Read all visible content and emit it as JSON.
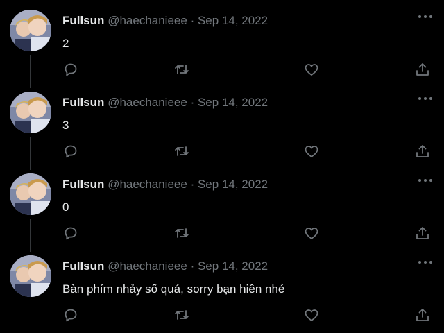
{
  "tweets": [
    {
      "name": "Fullsun",
      "handle": "@haechanieee",
      "separator": "·",
      "date": "Sep 14, 2022",
      "text": "2"
    },
    {
      "name": "Fullsun",
      "handle": "@haechanieee",
      "separator": "·",
      "date": "Sep 14, 2022",
      "text": "3"
    },
    {
      "name": "Fullsun",
      "handle": "@haechanieee",
      "separator": "·",
      "date": "Sep 14, 2022",
      "text": "0"
    },
    {
      "name": "Fullsun",
      "handle": "@haechanieee",
      "separator": "·",
      "date": "Sep 14, 2022",
      "text": "Bàn phím nhảy số quá, sorry bạn hiền nhé"
    }
  ],
  "icons": {
    "more": "more-icon",
    "reply": "reply-icon",
    "retweet": "retweet-icon",
    "like": "like-icon",
    "share": "share-icon"
  },
  "colors": {
    "background": "#000000",
    "primary_text": "#e7e9ea",
    "secondary_text": "#71767b",
    "thread_line": "#333639"
  }
}
